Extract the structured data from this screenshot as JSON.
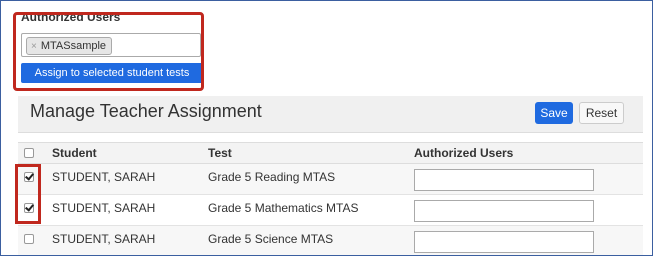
{
  "authorized_users": {
    "label": "Authorized Users",
    "tags": [
      {
        "text": "MTASsample",
        "remove_glyph": "×"
      }
    ],
    "assign_button": "Assign to selected student tests"
  },
  "panel": {
    "title": "Manage Teacher Assignment",
    "save_label": "Save",
    "reset_label": "Reset"
  },
  "table": {
    "headers": {
      "select_all": "",
      "student": "Student",
      "test": "Test",
      "authorized_users": "Authorized Users"
    },
    "rows": [
      {
        "checked": true,
        "student": "STUDENT, SARAH",
        "test": "Grade 5 Reading MTAS",
        "authorized_users": ""
      },
      {
        "checked": true,
        "student": "STUDENT, SARAH",
        "test": "Grade 5 Mathematics MTAS",
        "authorized_users": ""
      },
      {
        "checked": false,
        "student": "STUDENT, SARAH",
        "test": "Grade 5 Science MTAS",
        "authorized_users": ""
      }
    ]
  },
  "colors": {
    "primary_button": "#1f6ae0",
    "highlight_outline": "#c0281e",
    "frame_border": "#3b5fa0"
  }
}
